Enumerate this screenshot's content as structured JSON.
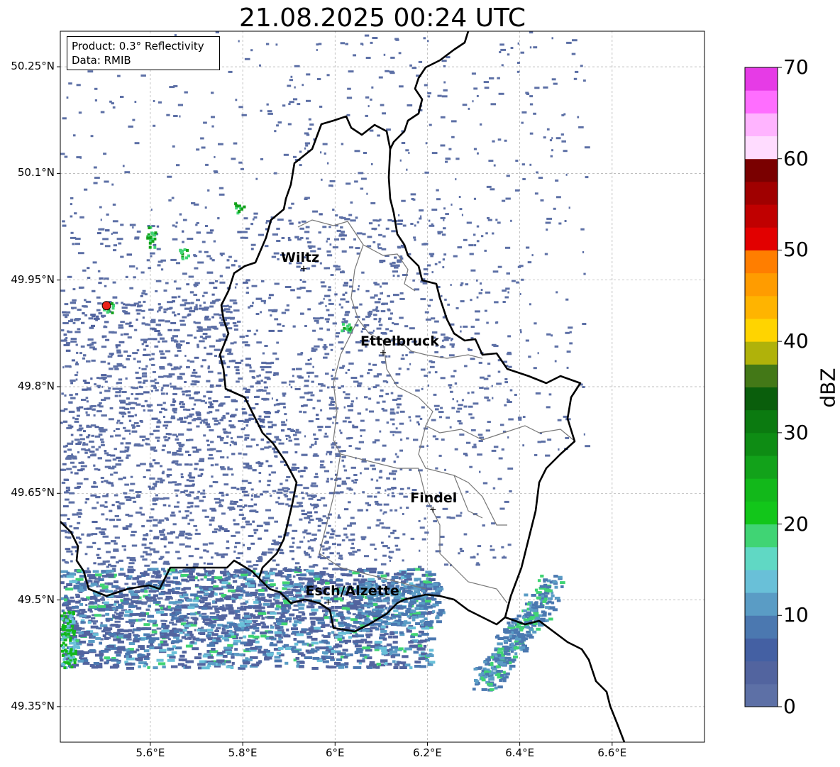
{
  "title": "21.08.2025 00:24 UTC",
  "info": {
    "product": "Product: 0.3° Reflectivity",
    "data": "Data: RMIB"
  },
  "lat_ticks": [
    "50.25°N",
    "50.1°N",
    "49.95°N",
    "49.8°N",
    "49.65°N",
    "49.5°N",
    "49.35°N"
  ],
  "lon_ticks": [
    "5.6°E",
    "5.8°E",
    "6°E",
    "6.2°E",
    "6.4°E",
    "6.6°E"
  ],
  "extent": {
    "lon_min": 5.405,
    "lon_max": 6.8,
    "lat_min": 49.3,
    "lat_max": 50.3
  },
  "cities": [
    {
      "name": "Wiltz",
      "lon": 5.932,
      "lat": 49.966
    },
    {
      "name": "Ettelbruck",
      "lon": 6.104,
      "lat": 49.848
    },
    {
      "name": "Findel",
      "lon": 6.212,
      "lat": 49.627
    },
    {
      "name": "Esch/Alzette",
      "lon": 5.985,
      "lat": 49.497
    }
  ],
  "radar_site": {
    "lon": 5.505,
    "lat": 49.914,
    "color": "#e8201a"
  },
  "colorbar": {
    "label": "dBZ",
    "ticks": [
      "0",
      "10",
      "20",
      "30",
      "40",
      "50",
      "60",
      "70"
    ],
    "min": 0,
    "max": 70,
    "step": 2.5,
    "colors": [
      "#5d70a6",
      "#52649f",
      "#4460a3",
      "#4b78b0",
      "#5a9cc5",
      "#69c0d8",
      "#60d8c4",
      "#40d474",
      "#12c61a",
      "#12b81a",
      "#12a21a",
      "#0e8c14",
      "#0b7a10",
      "#0a5e0c",
      "#437817",
      "#b0b20a",
      "#ffd400",
      "#ffb400",
      "#ff9c00",
      "#ff7e00",
      "#e20000",
      "#c00000",
      "#a00000",
      "#7a0000",
      "#ffdcff",
      "#ffb4ff",
      "#ff6eff",
      "#e63be6"
    ]
  }
}
